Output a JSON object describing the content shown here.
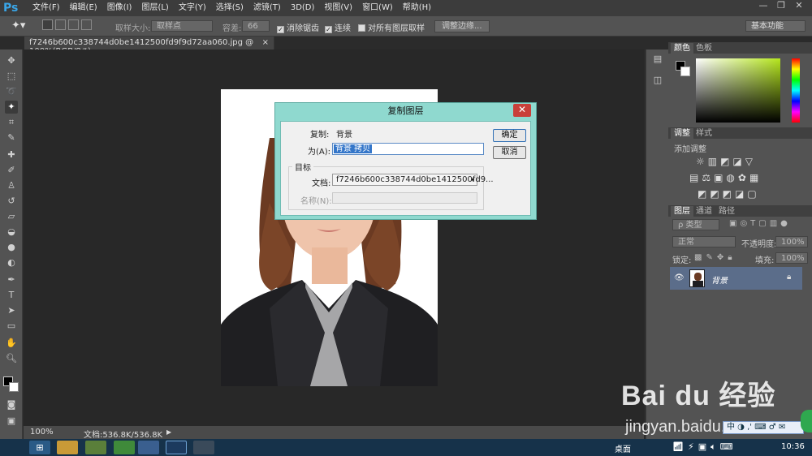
{
  "app": {
    "logo": "Ps"
  },
  "menu": [
    "文件(F)",
    "编辑(E)",
    "图像(I)",
    "图层(L)",
    "文字(Y)",
    "选择(S)",
    "滤镜(T)",
    "3D(D)",
    "视图(V)",
    "窗口(W)",
    "帮助(H)"
  ],
  "window_controls": {
    "minimize": "—",
    "restore": "❐",
    "close": "✕"
  },
  "options": {
    "sample_size_label": "取样大小:",
    "sample_size_value": "取样点",
    "tolerance_label": "容差:",
    "tolerance_value": "66",
    "antialias_label": "消除锯齿",
    "contiguous_label": "连续",
    "all_layers_label": "对所有图层取样",
    "refine_edge_label": "调整边缘...",
    "workspace_value": "基本功能"
  },
  "document_tab": {
    "title": "f7246b600c338744d0be1412500fd9f9d72aa060.jpg @ 100%(RGB/8#)",
    "close": "×"
  },
  "status": {
    "zoom": "100%",
    "doc_size": "文档:536.8K/536.8K"
  },
  "panels": {
    "color_tabs": [
      "颜色",
      "色板"
    ],
    "adjust_tabs": [
      "调整",
      "样式"
    ],
    "adjust_title": "添加调整",
    "layer_tabs": [
      "图层",
      "通道",
      "路径"
    ],
    "filter_kind": "ρ 类型",
    "blend_mode": "正常",
    "opacity_label": "不透明度:",
    "opacity_value": "100%",
    "lock_label": "锁定:",
    "fill_label": "填充:",
    "fill_value": "100%",
    "layer_name": "背景"
  },
  "dialog": {
    "title": "复制图层",
    "close": "✕",
    "copy_label": "复制:",
    "copy_value": "背景",
    "as_label": "为(A):",
    "as_value": "背景 拷贝",
    "ok_label": "确定",
    "cancel_label": "取消",
    "target_label": "目标",
    "doc_label": "文档:",
    "doc_value": "f7246b600c338744d0be1412500fd9...",
    "name_label": "名称(N):"
  },
  "watermark": {
    "brand": "Bai du 经验",
    "url": "jingyan.baidu.com"
  },
  "taskbar": {
    "desktop_label": "桌面",
    "time": "10:36",
    "ime": "中"
  },
  "colors": {
    "dialog_frame": "#8fd9cf",
    "close_red": "#c9403a",
    "ps_blue": "#3aa6e8",
    "layer_selected": "#5b6d8a"
  }
}
